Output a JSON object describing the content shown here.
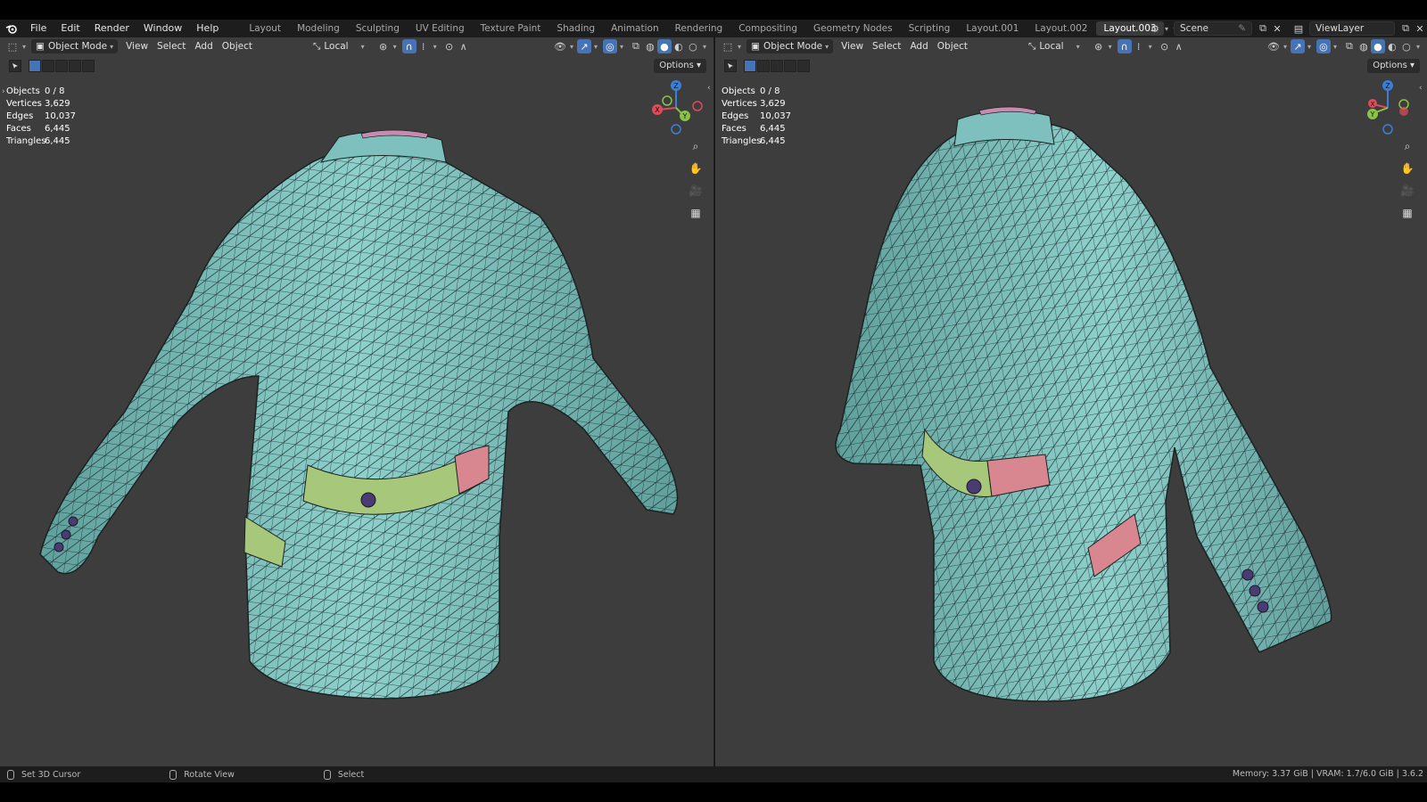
{
  "menu": [
    "File",
    "Edit",
    "Render",
    "Window",
    "Help"
  ],
  "workspaces": [
    "Layout",
    "Modeling",
    "Sculpting",
    "UV Editing",
    "Texture Paint",
    "Shading",
    "Animation",
    "Rendering",
    "Compositing",
    "Geometry Nodes",
    "Scripting",
    "Layout.001",
    "Layout.002",
    "Layout.003"
  ],
  "active_workspace": "Layout.003",
  "add_workspace": "+",
  "scene_name": "Scene",
  "view_layer": "ViewLayer",
  "viewport": {
    "mode": "Object Mode",
    "menus": [
      "View",
      "Select",
      "Add",
      "Object"
    ],
    "orientation": "Local",
    "options_label": "Options"
  },
  "stats": [
    {
      "label": "Objects",
      "value": "0 / 8"
    },
    {
      "label": "Vertices",
      "value": "3,629"
    },
    {
      "label": "Edges",
      "value": "10,037"
    },
    {
      "label": "Faces",
      "value": "6,445"
    },
    {
      "label": "Triangles",
      "value": "6,445"
    }
  ],
  "gizmo_axes": {
    "x": "X",
    "y": "Y",
    "z": "Z"
  },
  "colors": {
    "jacket": "#7ec0bd",
    "flap_green": "#a7c77b",
    "flap_pink": "#d8868f",
    "collar": "#c98ab0",
    "axis_x": "#e04a5b",
    "axis_y": "#8bc24a",
    "axis_z": "#3d7fd6",
    "active_blue": "#4772b3"
  },
  "status": {
    "left_action": "Set 3D Cursor",
    "middle_action": "Rotate View",
    "right_action": "Select",
    "info": "Memory: 3.37 GiB | VRAM: 1.7/6.0 GiB | 3.6.2"
  }
}
